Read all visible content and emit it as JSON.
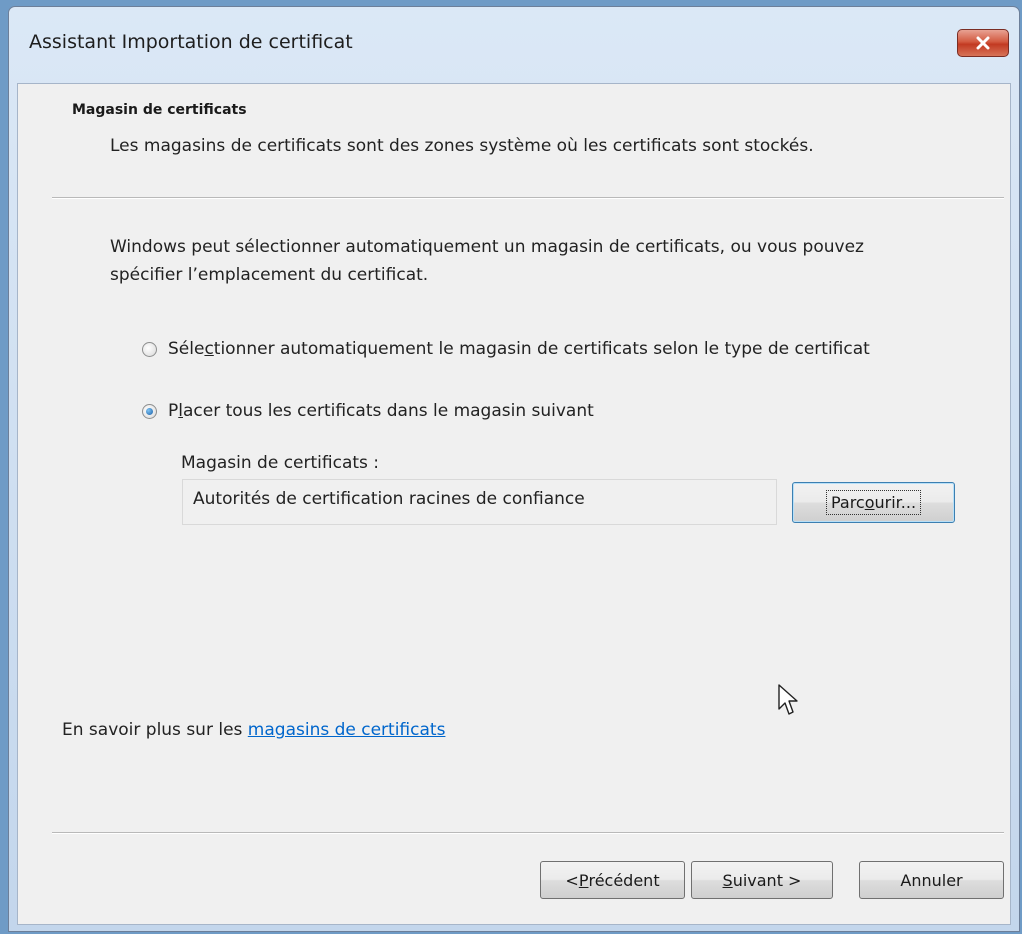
{
  "window": {
    "title": "Assistant Importation de certificat",
    "close_icon": "close-icon"
  },
  "header": {
    "title": "Magasin de certificats",
    "description": "Les magasins de certificats sont des zones système où les certificats sont stockés."
  },
  "intro_text": "Windows peut sélectionner automatiquement un magasin de certificats, ou vous pouvez spécifier l’emplacement du certificat.",
  "options": {
    "auto": {
      "label_pre": "Séle",
      "label_key": "c",
      "label_post": "tionner automatiquement le magasin de certificats selon le type de certificat",
      "checked": false
    },
    "manual": {
      "label_pre": "P",
      "label_key": "l",
      "label_post": "acer tous les certificats dans le magasin suivant",
      "checked": true
    }
  },
  "store": {
    "label": "Magasin de certificats :",
    "value": "Autorités de certification racines de confiance",
    "browse_pre": "Parc",
    "browse_key": "o",
    "browse_post": "urir..."
  },
  "info": {
    "prefix": "En savoir plus sur les ",
    "link_text": "magasins de certificats"
  },
  "footer": {
    "back_pre": "< ",
    "back_key": "P",
    "back_post": "récédent",
    "next_key": "S",
    "next_post": "uivant >",
    "cancel_label": "Annuler"
  },
  "colors": {
    "link": "#0066cc",
    "close_button": "#c23a22",
    "focus_border": "#3c7fb1"
  }
}
